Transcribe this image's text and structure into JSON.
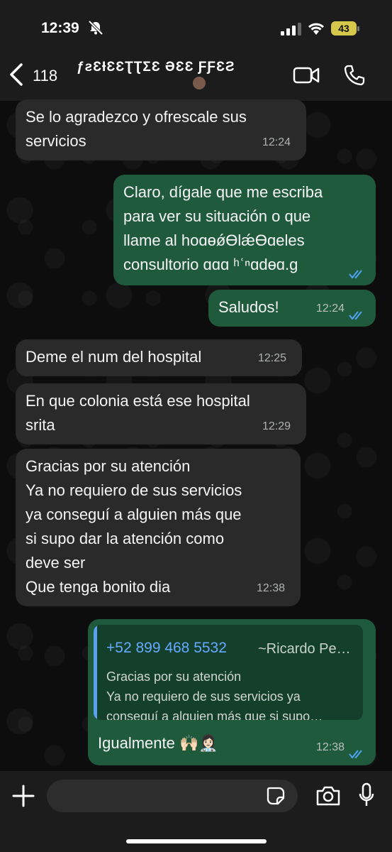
{
  "status_bar": {
    "time": "12:39",
    "battery": "43"
  },
  "header": {
    "unread_count": "118",
    "contact_name": "ƒƨƐƗƐƐƮƮƩƐ ƏƐƐ ƑƑƐƧ"
  },
  "messages": [
    {
      "dir": "in",
      "text": "Se lo agradezco y ofrescale sus\nservicios",
      "time": "12:24"
    },
    {
      "dir": "out",
      "text": "Claro, dígale que me escriba\npara ver su situación o que\nllame al hoɑɵǿƟlǽƟɑeles\nconsultorio ɑɑɑ ʰʿⁿɑdɵɑ.ɡ",
      "time": "",
      "read": true
    },
    {
      "dir": "out",
      "text": "Saludos!",
      "time": "12:24",
      "read": true
    },
    {
      "dir": "in",
      "text": "Deme el num del hospital",
      "time": "12:25"
    },
    {
      "dir": "in",
      "text": "En que colonia está ese hospital\nsrita",
      "time": "12:29"
    },
    {
      "dir": "in",
      "text": "Gracias por su atención\nYa no requiero de sus servicios\nya conseguí a alguien más que\nsi supo dar la atención como\ndeve ser\nQue tenga bonito dia",
      "time": "12:38"
    }
  ],
  "reply": {
    "quoted_phone": "+52 899 468 5532",
    "quoted_name": "~Ricardo Pe…",
    "quoted_lines": [
      "Gracias por su atención",
      "Ya no requiero de sus servicios ya",
      "conseguí a alguien más que si supo…"
    ],
    "text": "Igualmente 🙌🏻👩🏻‍⚕️",
    "time": "12:38",
    "read": true
  },
  "colors": {
    "incoming": "#2a2a2a",
    "outgoing": "#1f5a3c",
    "read_ticks": "#4fa3f7",
    "quote_bar": "#5aa0f0"
  },
  "icons": [
    "bell-off-icon",
    "signal-icon",
    "wifi-icon",
    "back-chevron-icon",
    "video-call-icon",
    "phone-call-icon",
    "plus-icon",
    "sticker-icon",
    "camera-icon",
    "mic-icon",
    "double-check-icon"
  ]
}
